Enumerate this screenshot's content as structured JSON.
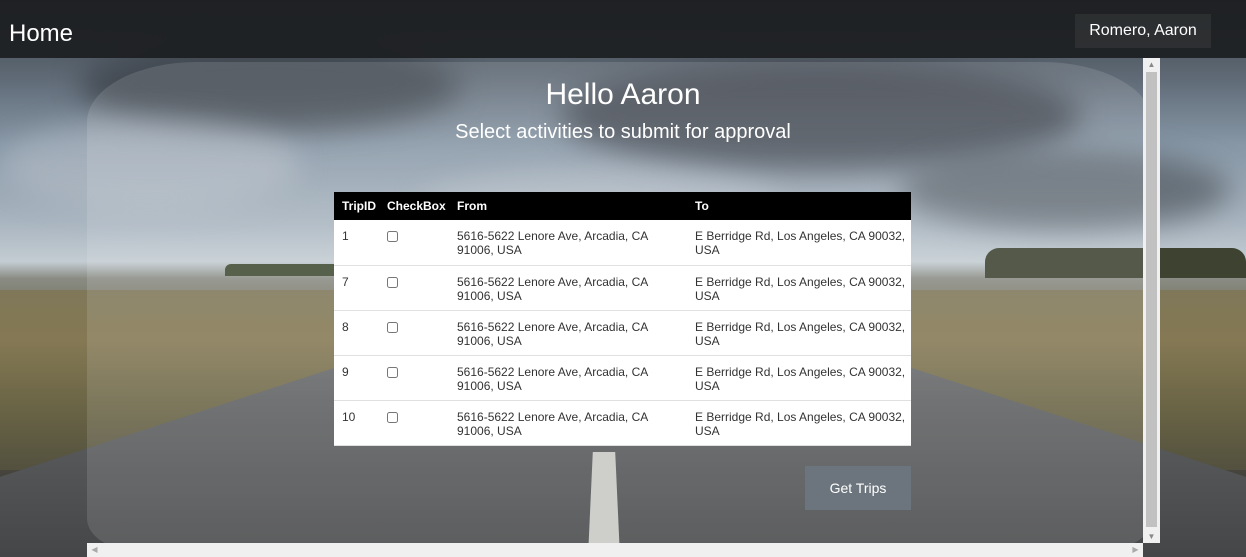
{
  "header": {
    "home_label": "Home",
    "user_label": "Romero, Aaron"
  },
  "main": {
    "greeting": "Hello Aaron",
    "subtitle": "Select activities to submit for approval",
    "get_trips_label": "Get Trips"
  },
  "table": {
    "columns": [
      "TripID",
      "CheckBox",
      "From",
      "To"
    ],
    "rows": [
      {
        "trip_id": "1",
        "from": "5616-5622 Lenore Ave, Arcadia, CA 91006, USA",
        "to": "E Berridge Rd, Los Angeles, CA 90032, USA"
      },
      {
        "trip_id": "7",
        "from": "5616-5622 Lenore Ave, Arcadia, CA 91006, USA",
        "to": "E Berridge Rd, Los Angeles, CA 90032, USA"
      },
      {
        "trip_id": "8",
        "from": "5616-5622 Lenore Ave, Arcadia, CA 91006, USA",
        "to": "E Berridge Rd, Los Angeles, CA 90032, USA"
      },
      {
        "trip_id": "9",
        "from": "5616-5622 Lenore Ave, Arcadia, CA 91006, USA",
        "to": "E Berridge Rd, Los Angeles, CA 90032, USA"
      },
      {
        "trip_id": "10",
        "from": "5616-5622 Lenore Ave, Arcadia, CA 91006, USA",
        "to": "E Berridge Rd, Los Angeles, CA 90032, USA"
      }
    ]
  },
  "icons": {
    "scroll_up": "chevron-up-icon",
    "scroll_down": "chevron-down-icon",
    "scroll_left": "chevron-left-icon",
    "scroll_right": "chevron-right-icon"
  },
  "colors": {
    "topbar": "#1c1e21",
    "table_header": "#000000",
    "button": "#6c757d"
  }
}
